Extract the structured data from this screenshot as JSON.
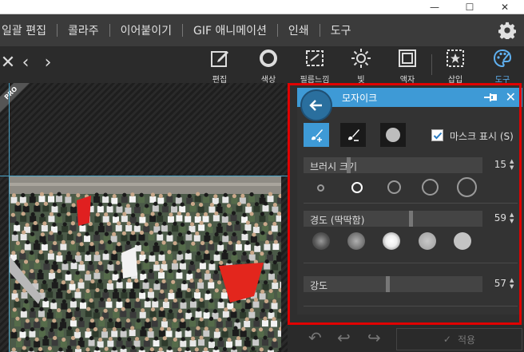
{
  "window": {
    "minimize": "—",
    "maximize": "☐",
    "close": "✕"
  },
  "menu": {
    "items": [
      "일괄 편집",
      "콜라주",
      "이어붙이기",
      "GIF 애니메이션",
      "인쇄",
      "도구"
    ]
  },
  "toolbar": {
    "tools": [
      {
        "label": "편집",
        "icon": "edit-icon"
      },
      {
        "label": "색상",
        "icon": "color-ring-icon"
      },
      {
        "label": "필름느낌",
        "icon": "film-icon"
      },
      {
        "label": "빛",
        "icon": "light-icon"
      },
      {
        "label": "액자",
        "icon": "frame-icon"
      },
      {
        "label": "삽입",
        "icon": "insert-star-icon"
      },
      {
        "label": "도구",
        "icon": "palette-icon"
      }
    ],
    "active_tool": "도구"
  },
  "canvas": {
    "badge": "PRO"
  },
  "mosaic_panel": {
    "title": "모자이크",
    "mask_label": "마스크 표시 (S)",
    "mask_checked": true,
    "brush_size": {
      "label": "브러시 크기",
      "value": "15",
      "level": 0.24
    },
    "hardness": {
      "label": "경도 (딱딱함)",
      "value": "59",
      "level": 0.59
    },
    "strength": {
      "label": "강도",
      "value": "57",
      "level": 0.46
    }
  },
  "bottom": {
    "apply_label": "적용"
  },
  "colors": {
    "accent": "#3e9ad6",
    "highlight_frame": "#e00000",
    "panel_bg": "#333333"
  }
}
